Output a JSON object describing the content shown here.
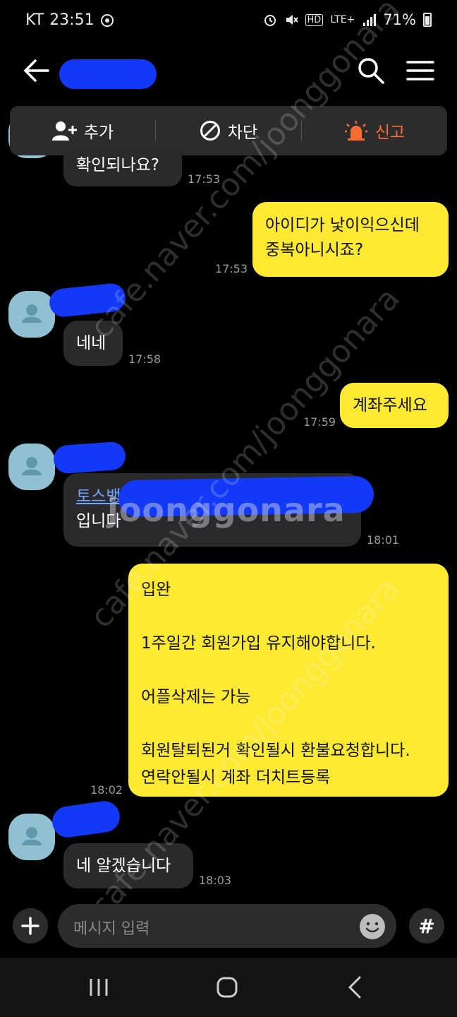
{
  "status": {
    "carrier": "KT",
    "time": "23:51",
    "network": "LTE+",
    "battery": "71%"
  },
  "actions": {
    "add": "추가",
    "block": "차단",
    "report": "신고"
  },
  "messages": [
    {
      "text": "확인되나요?",
      "time": "17:53"
    },
    {
      "text_line1": "아이디가 낯이익으신데",
      "text_line2": "중복아니시죠?",
      "time": "17:53"
    },
    {
      "text": "네네",
      "time": "17:58"
    },
    {
      "text": "계좌주세요",
      "time": "17:59"
    },
    {
      "link": "토스뱅크",
      "text": "입니다",
      "time": "18:01"
    },
    {
      "lines": [
        "입완",
        "1주일간 회원가입 유지해야합니다.",
        "어플삭제는 가능",
        "회원탈퇴된거 확인될시 환불요청합니다.",
        "연락안될시 계좌 더치트등록"
      ],
      "time": "18:02"
    },
    {
      "text": "네 알겠습니다",
      "time": "18:03"
    }
  ],
  "input": {
    "placeholder": "메시지 입력"
  },
  "watermark": {
    "site": "cafe.naver.com/joonggonara",
    "logo": "joonggonara",
    "brand": "joonggonara"
  },
  "colors": {
    "outgoing_bubble": "#fee933",
    "incoming_bubble": "#2a2a2c",
    "report_accent": "#ff6b2c",
    "redaction": "#1239f5",
    "avatar": "#8fc1d1"
  }
}
